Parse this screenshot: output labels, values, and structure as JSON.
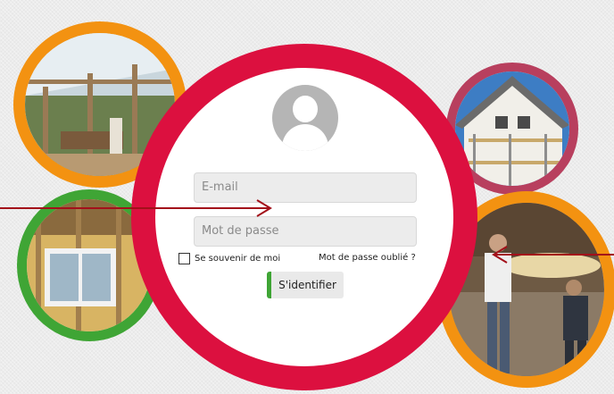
{
  "login": {
    "email_placeholder": "E-mail",
    "password_placeholder": "Mot de passe",
    "remember_label": "Se souvenir de moi",
    "forgot_label": "Mot de passe oublié ?",
    "submit_label": "S'identifier"
  },
  "colors": {
    "main_ring": "#dc103f",
    "orange_ring": "#f39211",
    "green_ring": "#3fa535",
    "plum_ring": "#b83f5e",
    "arrow": "#a3101a",
    "button_accent": "#3fa535"
  },
  "icons": [
    "user-avatar-icon",
    "arrow-right-icon",
    "arrow-left-icon"
  ],
  "images": [
    "veranda-photo",
    "window-insulation-photo",
    "house-scaffolding-photo",
    "attic-insulation-workers-photo"
  ]
}
